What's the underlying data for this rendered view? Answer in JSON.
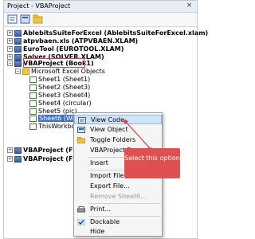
{
  "window": {
    "title": "Project - VBAProject",
    "close": "×"
  },
  "tree": [
    {
      "label": "AblebitsSuiteForExcel (AblebitsSuiteForExcel.xlam)",
      "bold": true
    },
    {
      "label": "atpvbaen.xls (ATPVBAEN.XLAM)",
      "bold": true
    },
    {
      "label": "EuroTool (EUROTOOL.XLAM)",
      "bold": true
    },
    {
      "label": "Solver (SOLVER.XLAM)",
      "bold": true
    },
    {
      "label": "VBAProject (Book1)",
      "bold": true
    },
    {
      "label": "Microsoft Excel Objects",
      "bold": false
    },
    {
      "label": "Sheet1 (Sheet1)",
      "bold": false
    },
    {
      "label": "Sheet2 (Sheet3)",
      "bold": false
    },
    {
      "label": "Sheet3 (Sheet4)",
      "bold": false
    },
    {
      "label": "Sheet4 (circular)",
      "bold": false
    },
    {
      "label": "Sheet5 (pic)",
      "bold": false
    },
    {
      "label": "Sheet6 (Wb...)",
      "bold": false
    },
    {
      "label": "ThisWorkbo...",
      "bold": false
    },
    {
      "label": "VBAProject (FIL...",
      "bold": true
    },
    {
      "label": "VBAProject (FUN...",
      "bold": true
    }
  ],
  "context_menu": [
    {
      "label": "View Code",
      "icon": "view-code-icon"
    },
    {
      "label": "View Object",
      "icon": "view-object-icon"
    },
    {
      "label": "Toggle Folders",
      "icon": "folder-icon"
    },
    {
      "label": "VBAProject Properties...",
      "icon": ""
    },
    {
      "label": "Insert",
      "icon": ""
    },
    {
      "label": "Import File...",
      "icon": ""
    },
    {
      "label": "Export File...",
      "icon": ""
    },
    {
      "label": "Remove Sheet6...",
      "icon": ""
    },
    {
      "label": "Print...",
      "icon": "print-icon"
    },
    {
      "label": "Dockable",
      "icon": "check-icon"
    },
    {
      "label": "Hide",
      "icon": ""
    }
  ],
  "callout": {
    "text": "Select this option"
  },
  "colors": {
    "highlight_box": "#e23b3b",
    "callout_bg": "#e05050",
    "selection": "#3f6fc8"
  }
}
